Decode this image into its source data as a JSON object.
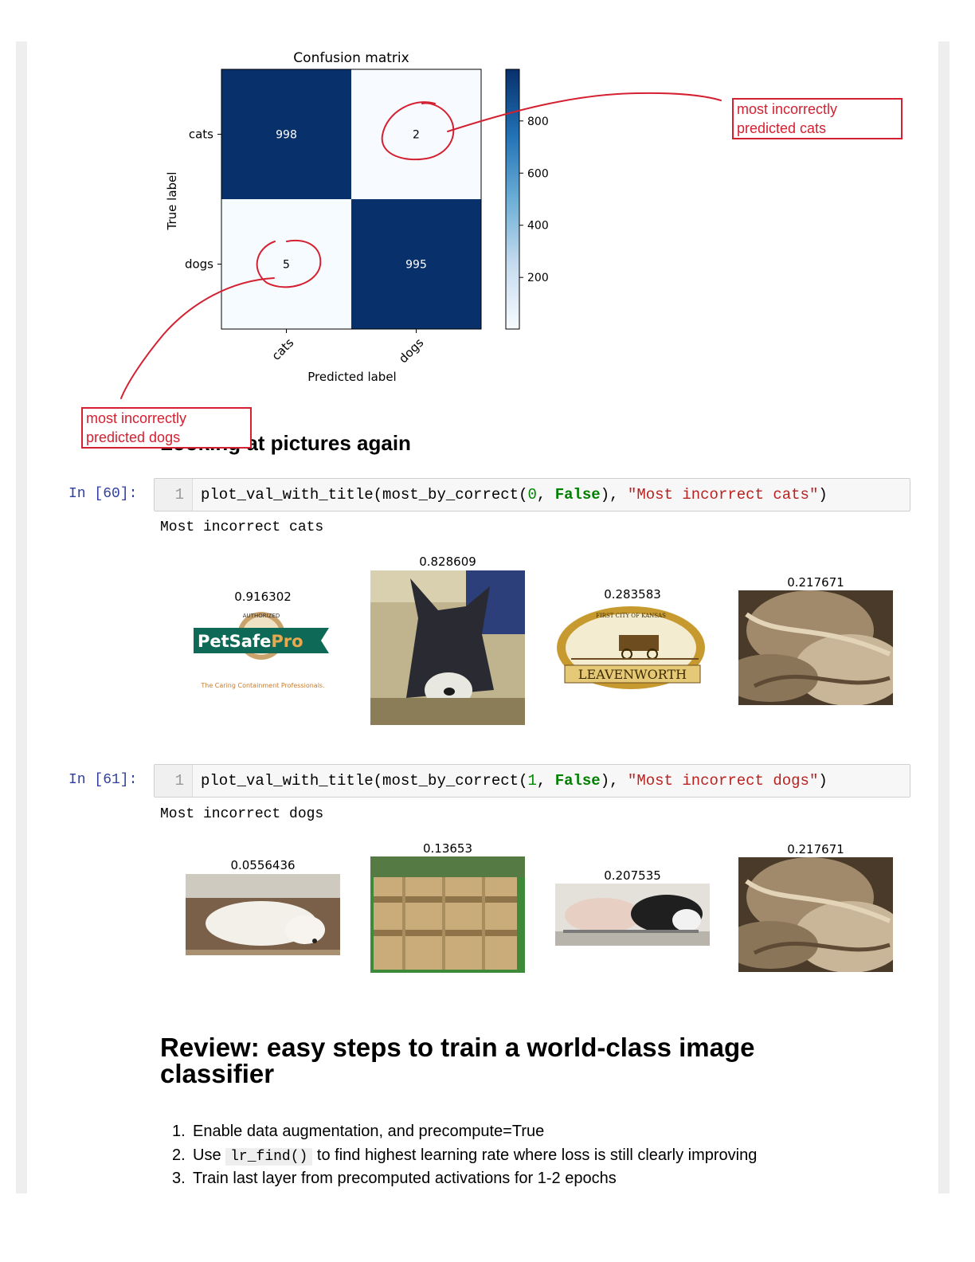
{
  "chart_data": {
    "type": "heatmap",
    "title": "Confusion matrix",
    "xlabel": "Predicted label",
    "ylabel": "True label",
    "x_categories": [
      "cats",
      "dogs"
    ],
    "y_categories": [
      "cats",
      "dogs"
    ],
    "values": [
      [
        998,
        2
      ],
      [
        5,
        995
      ]
    ],
    "colormap": "Blues",
    "colorbar_ticks": [
      800,
      600,
      400,
      200
    ],
    "colorbar_range": [
      2,
      998
    ]
  },
  "annotations": {
    "cats_lines": [
      "most incorrectly",
      "predicted cats"
    ],
    "dogs_lines": [
      "most incorrectly",
      "predicted dogs"
    ],
    "color": "#d42030"
  },
  "heading_pictures": "Looking at pictures again",
  "cells": [
    {
      "prompt": "In [60]:",
      "line_number": "1",
      "code_parts": [
        "plot_val_with_title(most_by_correct(",
        "0",
        ", ",
        "False",
        "), ",
        "\"Most incorrect cats\"",
        ")"
      ],
      "output": "Most incorrect cats",
      "images": [
        {
          "label": "0.916302",
          "desc": "PetSafe Pro logo"
        },
        {
          "label": "0.828609",
          "desc": "black and white kitten"
        },
        {
          "label": "0.283583",
          "desc": "Leavenworth seal"
        },
        {
          "label": "0.217671",
          "desc": "close-up fur"
        }
      ],
      "logo_text": {
        "seal": "AUTHORIZED",
        "brand": "PetSafe",
        "brand2": "Pro",
        "tagline": "The Caring Containment Professionals.",
        "seal2_top": "FIRST CITY OF KANSAS",
        "seal2_banner": "LEAVENWORTH"
      }
    },
    {
      "prompt": "In [61]:",
      "line_number": "1",
      "code_parts": [
        "plot_val_with_title(most_by_correct(",
        "1",
        ", ",
        "False",
        "), ",
        "\"Most incorrect dogs\"",
        ")"
      ],
      "output": "Most incorrect dogs",
      "images": [
        {
          "label": "0.0556436",
          "desc": "white dog lying on carpet"
        },
        {
          "label": "0.13653",
          "desc": "wooden fence"
        },
        {
          "label": "0.207535",
          "desc": "dogs on a bed"
        },
        {
          "label": "0.217671",
          "desc": "close-up fur"
        }
      ]
    }
  ],
  "heading_review": "Review: easy steps to train a world-class image classifier",
  "review_items": [
    {
      "num": "1.",
      "text": "Enable data augmentation, and precompute=True"
    },
    {
      "num": "2.",
      "pre": "Use ",
      "code": "lr_find()",
      "post": " to find highest learning rate where loss is still clearly improving"
    },
    {
      "num": "3.",
      "text": "Train last layer from precomputed activations for 1-2 epochs"
    }
  ]
}
